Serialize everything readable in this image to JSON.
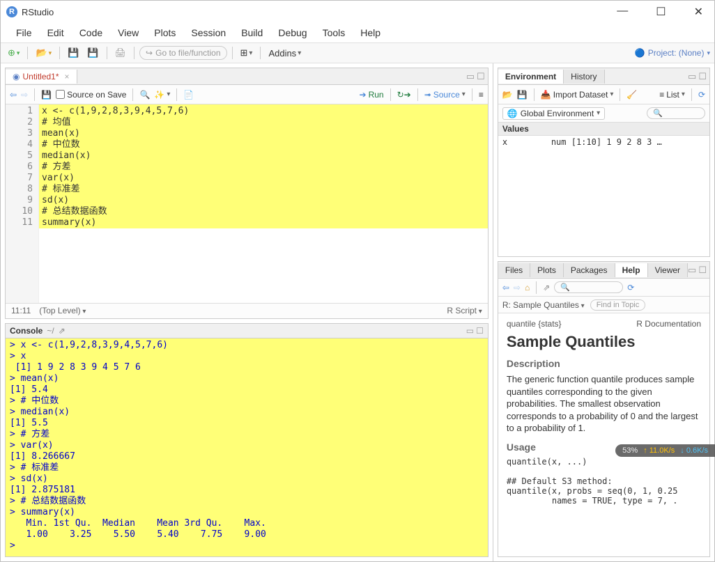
{
  "title": "RStudio",
  "menus": [
    "File",
    "Edit",
    "Code",
    "View",
    "Plots",
    "Session",
    "Build",
    "Debug",
    "Tools",
    "Help"
  ],
  "toolbar": {
    "goto_placeholder": "Go to file/function",
    "addins": "Addins",
    "project": "Project: (None)"
  },
  "source": {
    "tab": "Untitled1*",
    "source_on_save": "Source on Save",
    "run": "Run",
    "source_btn": "Source",
    "gutters": [
      "1",
      "2",
      "3",
      "4",
      "5",
      "6",
      "7",
      "8",
      "9",
      "10",
      "11"
    ],
    "code": "x <- c(1,9,2,8,3,9,4,5,7,6)\n# 均值\nmean(x)\n# 中位数\nmedian(x)\n# 方差\nvar(x)\n# 标准差\nsd(x)\n# 总结数据函数\nsummary(x)",
    "status_pos": "11:11",
    "status_scope": "(Top Level)",
    "status_type": "R Script"
  },
  "console": {
    "title": "Console",
    "path": "~/",
    "text": "> x <- c(1,9,2,8,3,9,4,5,7,6)\n> x\n [1] 1 9 2 8 3 9 4 5 7 6\n> mean(x)\n[1] 5.4\n> # 中位数\n> median(x)\n[1] 5.5\n> # 方差\n> var(x)\n[1] 8.266667\n> # 标准差\n> sd(x)\n[1] 2.875181\n> # 总结数据函数\n> summary(x)\n   Min. 1st Qu.  Median    Mean 3rd Qu.    Max.\n   1.00    3.25    5.50    5.40    7.75    9.00\n> "
  },
  "env": {
    "tabs": [
      "Environment",
      "History"
    ],
    "import": "Import Dataset",
    "list": "List",
    "scope": "Global Environment",
    "values_hdr": "Values",
    "row": {
      "name": "x",
      "detail": "num [1:10] 1 9 2 8 3 …"
    }
  },
  "help": {
    "tabs": [
      "Files",
      "Plots",
      "Packages",
      "Help",
      "Viewer"
    ],
    "search_placeholder": "",
    "breadcrumb": "R: Sample Quantiles",
    "find_placeholder": "Find in Topic",
    "doc_id": "quantile {stats}",
    "doc_right": "R Documentation",
    "h1": "Sample Quantiles",
    "desc_h": "Description",
    "desc": "The generic function quantile produces sample quantiles corresponding to the given probabilities. The smallest observation corresponds to a probability of 0 and the largest to a probability of 1.",
    "usage_h": "Usage",
    "usage": "quantile(x, ...)\n\n## Default S3 method:\nquantile(x, probs = seq(0, 1, 0.25\n         names = TRUE, type = 7, ."
  },
  "overlay": {
    "pct": "53%",
    "up": "11.0K/s",
    "down": "0.6K/s"
  }
}
